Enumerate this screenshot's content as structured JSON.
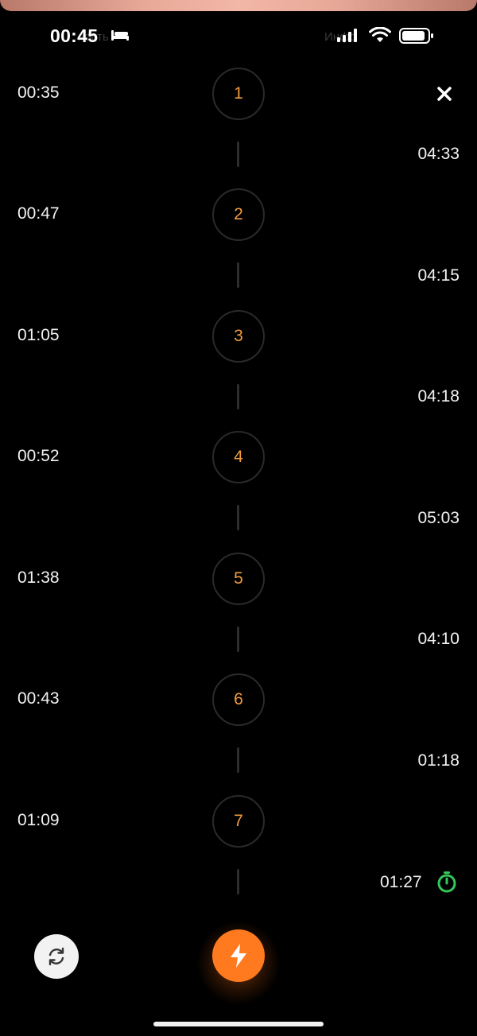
{
  "status_bar": {
    "time": "00:45",
    "ghost_left": "ность",
    "ghost_right": "Инфо"
  },
  "laps": [
    {
      "number": "1",
      "lap_time": "00:35"
    },
    {
      "number": "2",
      "lap_time": "00:47"
    },
    {
      "number": "3",
      "lap_time": "01:05"
    },
    {
      "number": "4",
      "lap_time": "00:52"
    },
    {
      "number": "5",
      "lap_time": "01:38"
    },
    {
      "number": "6",
      "lap_time": "00:43"
    },
    {
      "number": "7",
      "lap_time": "01:09"
    }
  ],
  "splits": [
    "04:33",
    "04:15",
    "04:18",
    "05:03",
    "04:10",
    "01:18"
  ],
  "active_split": "01:27",
  "colors": {
    "accent_orange": "#ff7a1e",
    "lap_number": "#f19a3e",
    "active_green": "#34c759",
    "background": "#000000"
  },
  "icons": {
    "close": "close-icon",
    "reset": "reset-icon",
    "flash": "lightning-icon",
    "stopwatch": "stopwatch-icon"
  }
}
